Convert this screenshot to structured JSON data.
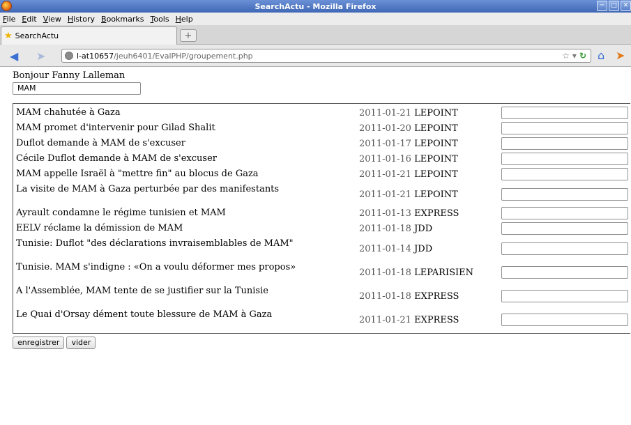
{
  "window": {
    "title": "SearchActu - Mozilla Firefox"
  },
  "menu": [
    "File",
    "Edit",
    "View",
    "History",
    "Bookmarks",
    "Tools",
    "Help"
  ],
  "tab": {
    "label": "SearchActu",
    "new_tab_symbol": "+"
  },
  "url": {
    "host": "l-at10657",
    "path": "/jeuh6401/EvalPHP/groupement.php"
  },
  "page": {
    "greeting": "Bonjour Fanny Lalleman",
    "search_value": "MAM",
    "buttons": {
      "save": "enregistrer",
      "clear": "vider"
    },
    "results": [
      {
        "title": "MAM chahutée à Gaza",
        "date": "2011-01-21",
        "source": "LEPOINT"
      },
      {
        "title": "MAM promet d'intervenir pour Gilad Shalit",
        "date": "2011-01-20",
        "source": "LEPOINT"
      },
      {
        "title": "Duflot demande à MAM de s'excuser",
        "date": "2011-01-17",
        "source": "LEPOINT"
      },
      {
        "title": "Cécile Duflot demande à MAM de s'excuser",
        "date": "2011-01-16",
        "source": "LEPOINT"
      },
      {
        "title": "MAM appelle Israël à \"mettre fin\" au blocus de Gaza",
        "date": "2011-01-21",
        "source": "LEPOINT"
      },
      {
        "title": "La visite de MAM à Gaza perturbée par des manifestants",
        "date": "2011-01-21",
        "source": "LEPOINT"
      },
      {
        "title": "Ayrault condamne le régime tunisien et MAM",
        "date": "2011-01-13",
        "source": "EXPRESS"
      },
      {
        "title": "EELV réclame la démission de MAM",
        "date": "2011-01-18",
        "source": "JDD"
      },
      {
        "title": "Tunisie: Duflot \"des déclarations invraisemblables de MAM\"",
        "date": "2011-01-14",
        "source": "JDD"
      },
      {
        "title": "Tunisie. MAM s'indigne : «On a voulu déformer mes propos»",
        "date": "2011-01-18",
        "source": "LEPARISIEN"
      },
      {
        "title": "A l'Assemblée, MAM tente de se justifier sur la Tunisie",
        "date": "2011-01-18",
        "source": "EXPRESS"
      },
      {
        "title": "Le Quai d'Orsay dément toute blessure de MAM à Gaza",
        "date": "2011-01-21",
        "source": "EXPRESS"
      }
    ]
  },
  "colors": {
    "titlebar": "#3f67b5",
    "accent": "#3b6fd2"
  },
  "icons": [
    "firefox-icon",
    "back-arrow-icon",
    "forward-arrow-icon",
    "globe-icon",
    "star-icon",
    "reload-icon",
    "home-icon",
    "share-icon"
  ]
}
